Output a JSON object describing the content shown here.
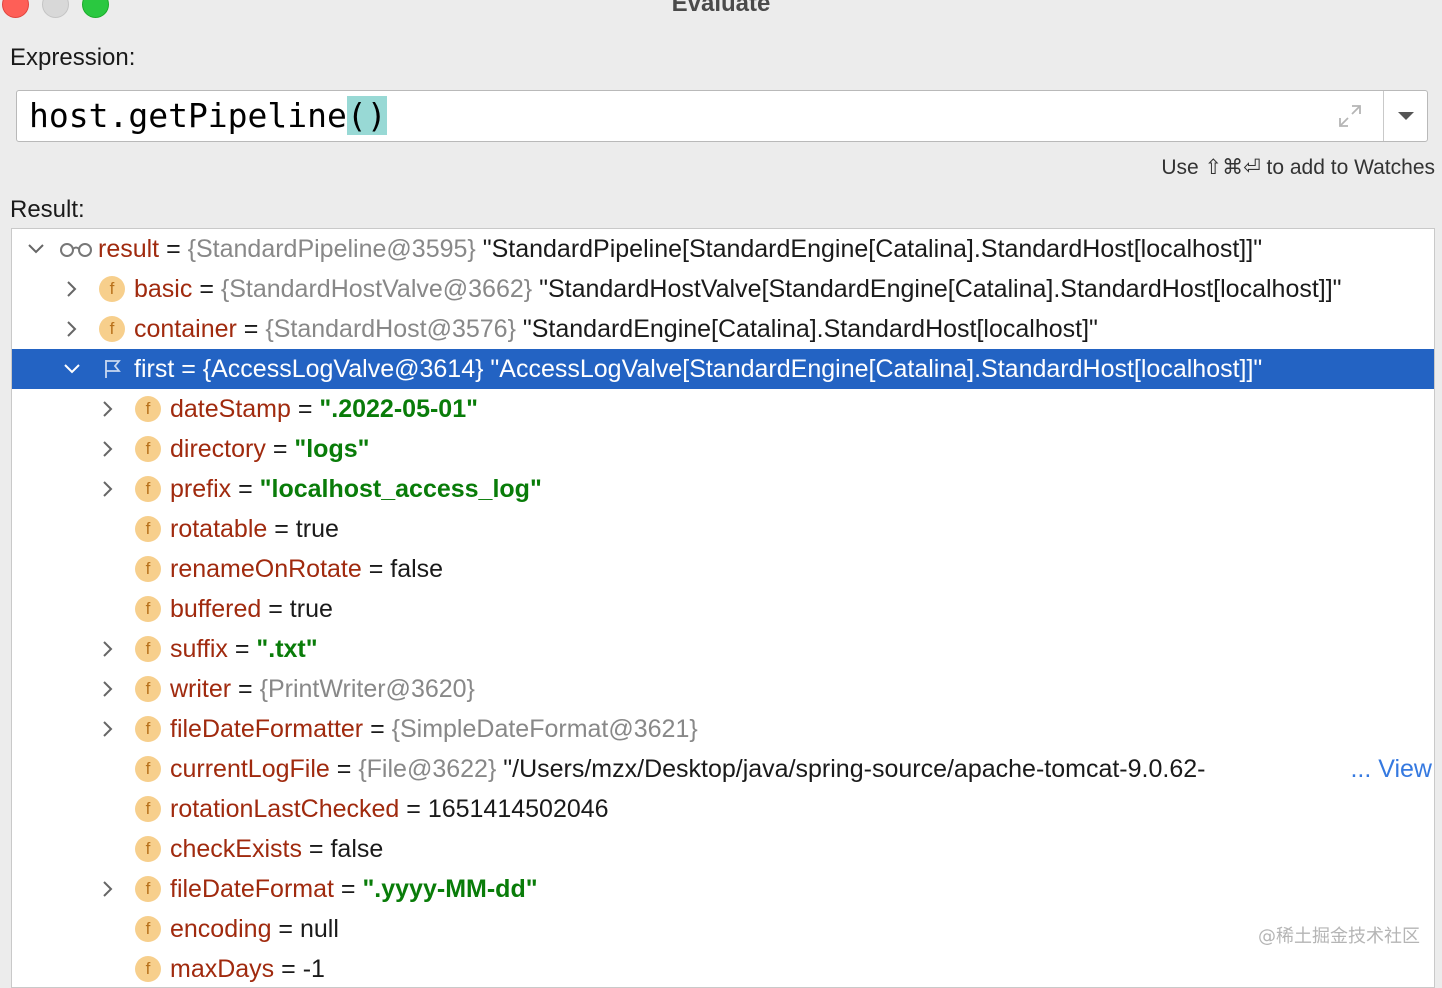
{
  "window": {
    "title": "Evaluate"
  },
  "expression": {
    "label": "Expression:",
    "code": "host.getPipeline",
    "code_parens": "()"
  },
  "hint": "Use ⇧⌘⏎ to add to Watches",
  "result_label": "Result:",
  "tree": {
    "root": {
      "name": "result",
      "eq": " = ",
      "type": "{StandardPipeline@3595}",
      "value": " \"StandardPipeline[StandardEngine[Catalina].StandardHost[localhost]]\""
    },
    "basic": {
      "name": "basic",
      "eq": " = ",
      "type": "{StandardHostValve@3662}",
      "value": " \"StandardHostValve[StandardEngine[Catalina].StandardHost[localhost]]\""
    },
    "container": {
      "name": "container",
      "eq": " = ",
      "type": "{StandardHost@3576}",
      "value": " \"StandardEngine[Catalina].StandardHost[localhost]\""
    },
    "first": {
      "name": "first",
      "eq": " = ",
      "type": "{AccessLogValve@3614}",
      "value": " \"AccessLogValve[StandardEngine[Catalina].StandardHost[localhost]]\""
    },
    "fields": [
      {
        "name": "dateStamp",
        "eq": " = ",
        "string": "\".2022-05-01\""
      },
      {
        "name": "directory",
        "eq": " = ",
        "string": "\"logs\""
      },
      {
        "name": "prefix",
        "eq": " = ",
        "string": "\"localhost_access_log\""
      },
      {
        "name": "rotatable",
        "eq": " = ",
        "value": "true"
      },
      {
        "name": "renameOnRotate",
        "eq": " = ",
        "value": "false"
      },
      {
        "name": "buffered",
        "eq": " = ",
        "value": "true"
      },
      {
        "name": "suffix",
        "eq": " = ",
        "string": "\".txt\""
      },
      {
        "name": "writer",
        "eq": " = ",
        "type": "{PrintWriter@3620}"
      },
      {
        "name": "fileDateFormatter",
        "eq": " = ",
        "type": "{SimpleDateFormat@3621}"
      },
      {
        "name": "currentLogFile",
        "eq": " = ",
        "type": "{File@3622}",
        "value": " \"/Users/mzx/Desktop/java/spring-source/apache-tomcat-9.0.62-",
        "more": "... View"
      },
      {
        "name": "rotationLastChecked",
        "eq": " = ",
        "value": "1651414502046"
      },
      {
        "name": "checkExists",
        "eq": " = ",
        "value": "false"
      },
      {
        "name": "fileDateFormat",
        "eq": " = ",
        "string": "\".yyyy-MM-dd\""
      },
      {
        "name": "encoding",
        "eq": " = ",
        "value": "null"
      },
      {
        "name": "maxDays",
        "eq": " = ",
        "value": "-1"
      }
    ]
  },
  "field_icon_letter": "f",
  "icons": {
    "watch": "glasses-icon",
    "field": "field-icon",
    "flag": "flag-icon",
    "expand": "expand-icon",
    "dropdown": "chevron-down-icon"
  },
  "colors": {
    "selection": "#2363c3",
    "field_name": "#a02a0e",
    "string": "#097c09",
    "type": "#888888",
    "paren_highlight": "#98d9d5"
  },
  "watermark": "@稀土掘金技术社区"
}
